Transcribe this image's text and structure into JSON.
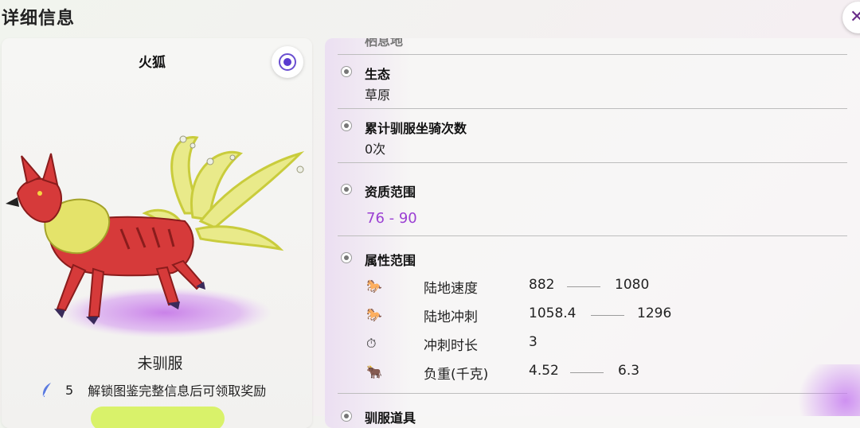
{
  "header": {
    "title": "详细信息",
    "close_icon": "close-icon"
  },
  "creature": {
    "name": "火狐",
    "tame_status": "未驯服",
    "reward_count": "5",
    "reward_text": "解锁图鉴完整信息后可领取奖励"
  },
  "info": {
    "partial_top_title": "栖息地",
    "ecology": {
      "title": "生态",
      "value": "草原"
    },
    "tame_count": {
      "title": "累计驯服坐骑次数",
      "value": "0次"
    },
    "quality": {
      "title": "资质范围",
      "value": "76 - 90"
    },
    "attributes": {
      "title": "属性范围",
      "rows": [
        {
          "icon": "land-speed-icon",
          "name": "陆地速度",
          "min": "882",
          "max": "1080"
        },
        {
          "icon": "land-sprint-icon",
          "name": "陆地冲刺",
          "min": "1058.4",
          "max": "1296"
        },
        {
          "icon": "sprint-duration-icon",
          "name": "冲刺时长",
          "min": "3",
          "max": ""
        },
        {
          "icon": "load-weight-icon",
          "name": "负重(千克)",
          "min": "4.52",
          "max": "6.3"
        }
      ]
    },
    "tame_item": {
      "title": "驯服道具"
    }
  },
  "colors": {
    "accent_purple": "#9b3fd3",
    "reward_green": "#d9f26a",
    "fox_red": "#d63a3a"
  }
}
